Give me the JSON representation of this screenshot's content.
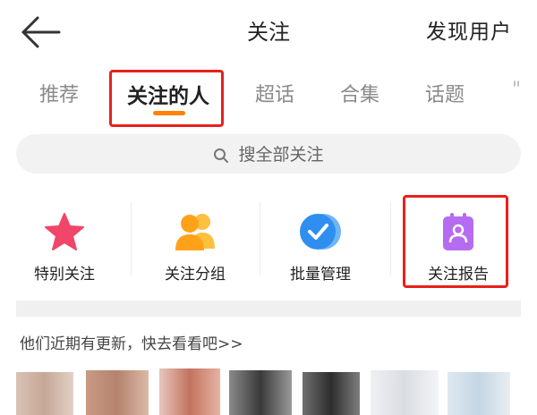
{
  "header": {
    "back_icon": "arrow-left-icon",
    "title": "关注",
    "action_label": "发现用户"
  },
  "tabs": [
    {
      "label": "推荐",
      "active": false
    },
    {
      "label": "关注的人",
      "active": true
    },
    {
      "label": "超话",
      "active": false
    },
    {
      "label": "合集",
      "active": false
    },
    {
      "label": "话题",
      "active": false
    }
  ],
  "search": {
    "icon": "search-icon",
    "placeholder": "搜全部关注"
  },
  "shortcuts": [
    {
      "label": "特别关注",
      "icon": "star-icon",
      "color": "#f1456a"
    },
    {
      "label": "关注分组",
      "icon": "group-icon",
      "color": "#ffa21a"
    },
    {
      "label": "批量管理",
      "icon": "check-circle-icon",
      "color": "#2f8ff0"
    },
    {
      "label": "关注报告",
      "icon": "report-icon",
      "color": "#b56cf0"
    }
  ],
  "updates": {
    "text": "他们近期有更新，快去看看吧>>"
  },
  "colors": {
    "accent": "#ff8200",
    "highlight": "#e8201b"
  }
}
